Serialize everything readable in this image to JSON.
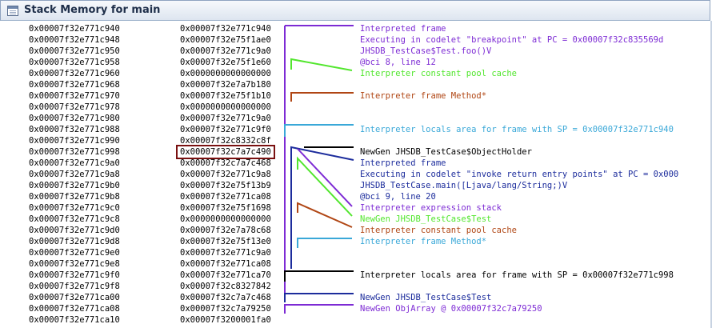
{
  "window": {
    "title": "Stack Memory for main"
  },
  "colors": {
    "purple": "#7d2bd4",
    "blue": "#1c2c9c",
    "green": "#52e62e",
    "brown": "#b04614",
    "cyan": "#3aa8d8",
    "black": "#000000",
    "highlight_border": "#7a1111"
  },
  "rows": [
    {
      "addr": "0x00007f32e771c940",
      "val": "0x00007f32e771c940",
      "ann": "Interpreted frame",
      "color": "#7d2bd4"
    },
    {
      "addr": "0x00007f32e771c948",
      "val": "0x00007f32e75f1ae0",
      "ann": "Executing in codelet \"breakpoint\" at PC = 0x00007f32c835569d",
      "color": "#7d2bd4"
    },
    {
      "addr": "0x00007f32e771c950",
      "val": "0x00007f32e771c9a0",
      "ann": "JHSDB_TestCase$Test.foo()V",
      "color": "#7d2bd4"
    },
    {
      "addr": "0x00007f32e771c958",
      "val": "0x00007f32e75f1e60",
      "ann": "@bci 8, line 12",
      "color": "#7d2bd4"
    },
    {
      "addr": "0x00007f32e771c960",
      "val": "0x0000000000000000",
      "ann": "Interpreter constant pool cache",
      "color": "#52e62e"
    },
    {
      "addr": "0x00007f32e771c968",
      "val": "0x00007f32e7a7b180",
      "ann": "",
      "color": ""
    },
    {
      "addr": "0x00007f32e771c970",
      "val": "0x00007f32e75f1b10",
      "ann": "Interpreter frame Method*",
      "color": "#b04614"
    },
    {
      "addr": "0x00007f32e771c978",
      "val": "0x0000000000000000",
      "ann": "",
      "color": ""
    },
    {
      "addr": "0x00007f32e771c980",
      "val": "0x00007f32e771c9a0",
      "ann": "",
      "color": ""
    },
    {
      "addr": "0x00007f32e771c988",
      "val": "0x00007f32e771c9f0",
      "ann": "Interpreter locals area for frame with SP = 0x00007f32e771c940",
      "color": "#3aa8d8"
    },
    {
      "addr": "0x00007f32e771c990",
      "val": "0x00007f32c8332c8f",
      "ann": "",
      "color": ""
    },
    {
      "addr": "0x00007f32e771c998",
      "val": "0x00007f32c7a7c490",
      "ann": "NewGen JHSDB_TestCase$ObjectHolder",
      "color": "#000000",
      "highlight": true
    },
    {
      "addr": "0x00007f32e771c9a0",
      "val": "0x00007f32c7a7c468",
      "ann": "Interpreted frame",
      "color": "#1c2c9c"
    },
    {
      "addr": "0x00007f32e771c9a8",
      "val": "0x00007f32e771c9a8",
      "ann": "Executing in codelet \"invoke return entry points\" at PC = 0x000",
      "color": "#1c2c9c"
    },
    {
      "addr": "0x00007f32e771c9b0",
      "val": "0x00007f32e75f13b9",
      "ann": "JHSDB_TestCase.main([Ljava/lang/String;)V",
      "color": "#1c2c9c"
    },
    {
      "addr": "0x00007f32e771c9b8",
      "val": "0x00007f32e771ca08",
      "ann": "@bci 9, line 20",
      "color": "#1c2c9c"
    },
    {
      "addr": "0x00007f32e771c9c0",
      "val": "0x00007f32e75f1698",
      "ann": "Interpreter expression stack",
      "color": "#7d2bd4"
    },
    {
      "addr": "0x00007f32e771c9c8",
      "val": "0x0000000000000000",
      "ann": "NewGen JHSDB_TestCase$Test",
      "color": "#52e62e"
    },
    {
      "addr": "0x00007f32e771c9d0",
      "val": "0x00007f32e7a78c68",
      "ann": "Interpreter constant pool cache",
      "color": "#b04614"
    },
    {
      "addr": "0x00007f32e771c9d8",
      "val": "0x00007f32e75f13e0",
      "ann": "Interpreter frame Method*",
      "color": "#3aa8d8"
    },
    {
      "addr": "0x00007f32e771c9e0",
      "val": "0x00007f32e771c9a0",
      "ann": "",
      "color": ""
    },
    {
      "addr": "0x00007f32e771c9e8",
      "val": "0x00007f32e771ca08",
      "ann": "",
      "color": ""
    },
    {
      "addr": "0x00007f32e771c9f0",
      "val": "0x00007f32e771ca70",
      "ann": "Interpreter locals area for frame with SP = 0x00007f32e771c998",
      "color": "#000000"
    },
    {
      "addr": "0x00007f32e771c9f8",
      "val": "0x00007f32c8327842",
      "ann": "",
      "color": ""
    },
    {
      "addr": "0x00007f32e771ca00",
      "val": "0x00007f32c7a7c468",
      "ann": "NewGen JHSDB_TestCase$Test",
      "color": "#1c2c9c"
    },
    {
      "addr": "0x00007f32e771ca08",
      "val": "0x00007f32c7a79250",
      "ann": "NewGen ObjArray @ 0x00007f32c7a79250",
      "color": "#7d2bd4"
    },
    {
      "addr": "0x00007f32e771ca10",
      "val": "0x00007f3200001fa0",
      "ann": "",
      "color": ""
    }
  ]
}
